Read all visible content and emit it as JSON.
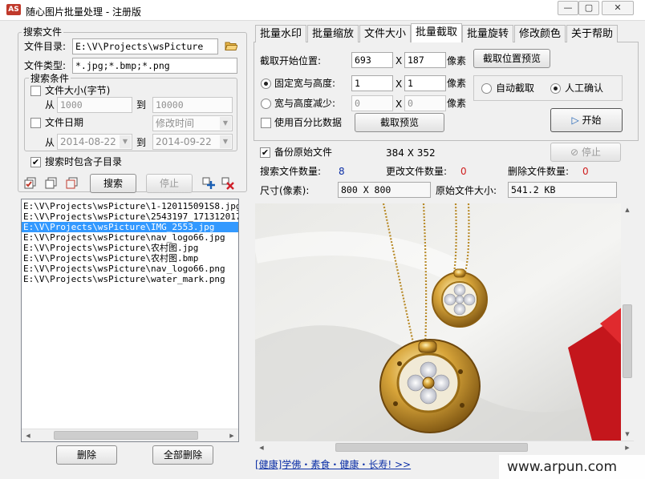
{
  "window": {
    "logo": "AS",
    "title": "随心图片批量处理 - 注册版",
    "min": "—",
    "restore": "▢",
    "close": "✕"
  },
  "search": {
    "group_title": "搜索文件",
    "dir_label": "文件目录:",
    "dir_value": "E:\\V\\Projects\\wsPicture",
    "type_label": "文件类型:",
    "type_value": "*.jpg;*.bmp;*.png",
    "cond_title": "搜索条件",
    "size_label": "文件大小(字节)",
    "size_from_label": "从",
    "size_from": "1000",
    "size_to_label": "到",
    "size_to": "10000",
    "date_label": "文件日期",
    "date_mode": "修改时间",
    "date_from_label": "从",
    "date_from": "2014-08-22",
    "date_to_label": "到",
    "date_to": "2014-09-22",
    "subdir_label": "搜索时包含子目录",
    "search_btn": "搜索",
    "stop_btn": "停止"
  },
  "files": [
    "E:\\V\\Projects\\wsPicture\\1-120115091S8.jpg",
    "E:\\V\\Projects\\wsPicture\\2543197_171312017000_2.jpg",
    "E:\\V\\Projects\\wsPicture\\IMG_2553.jpg",
    "E:\\V\\Projects\\wsPicture\\nav_logo66.jpg",
    "E:\\V\\Projects\\wsPicture\\农村图.jpg",
    "E:\\V\\Projects\\wsPicture\\农村图.bmp",
    "E:\\V\\Projects\\wsPicture\\nav_logo66.png",
    "E:\\V\\Projects\\wsPicture\\water_mark.png"
  ],
  "selected_file_index": 2,
  "list_buttons": {
    "delete": "删除",
    "delete_all": "全部删除"
  },
  "tabs": [
    "批量水印",
    "批量缩放",
    "文件大小",
    "批量截取",
    "批量旋转",
    "修改颜色",
    "关于帮助"
  ],
  "active_tab": 3,
  "crop": {
    "start_label": "截取开始位置:",
    "start_x": "693",
    "x_sep": "X",
    "start_y": "187",
    "unit": "像素",
    "preview_pos_btn": "截取位置预览",
    "fixed_label": "固定宽与高度:",
    "fixed_w": "1",
    "fixed_h": "1",
    "reduce_label": "宽与高度减少:",
    "reduce_w": "0",
    "reduce_h": "0",
    "percent_label": "使用百分比数据",
    "preview_btn": "截取预览",
    "auto_label": "自动截取",
    "manual_label": "人工确认",
    "start_btn": "开始"
  },
  "status": {
    "backup_label": "备份原始文件",
    "dims": "384 X 352",
    "stop_btn": "停止",
    "search_count_label": "搜索文件数量:",
    "search_count": "8",
    "changed_label": "更改文件数量:",
    "changed": "0",
    "deleted_label": "删除文件数量:",
    "deleted": "0",
    "size_label": "尺寸(像素):",
    "size_value": "800 X 800",
    "orig_size_label": "原始文件大小:",
    "orig_size_value": "541.2 KB"
  },
  "footer": {
    "link": "[健康]学佛・素食・健康・长寿!  >>",
    "watermark": "www.arpun.com"
  },
  "colors": {
    "selection": "#3399ff",
    "count_blue": "#0b2fa6",
    "count_red": "#cf1d1d",
    "gold": "#c99a2e"
  },
  "icons": [
    "app-logo-icon",
    "minimize-icon",
    "restore-icon",
    "close-icon",
    "folder-open-icon",
    "check-all-icon",
    "copy-icon",
    "copy-icon",
    "add-icon",
    "remove-icon",
    "play-icon",
    "stop-icon"
  ]
}
